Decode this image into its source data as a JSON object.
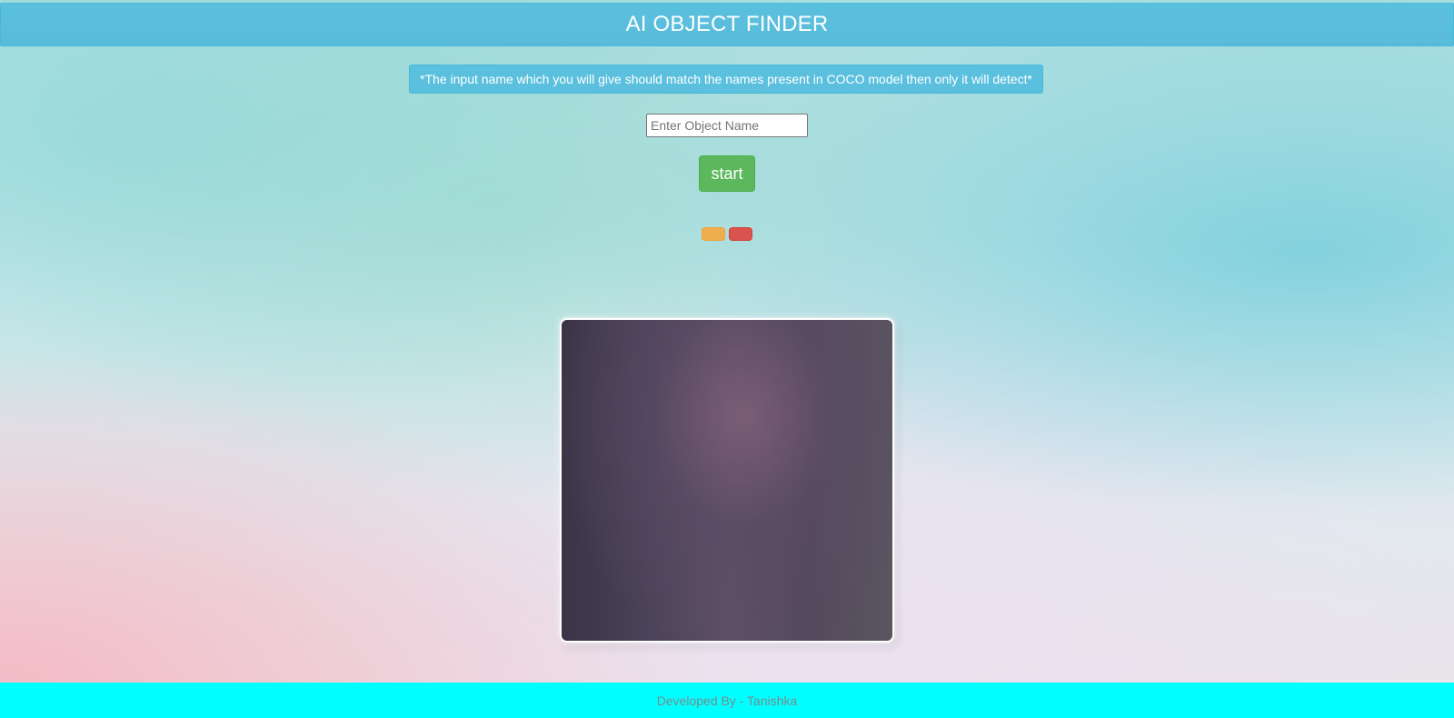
{
  "header": {
    "title": "AI OBJECT FINDER"
  },
  "notice": {
    "text": "*The input name which you will give should match the names present in COCO model then only it will detect*"
  },
  "object_input": {
    "placeholder": "Enter Object Name",
    "value": ""
  },
  "controls": {
    "start_label": "start",
    "warning_button_label": "",
    "danger_button_label": ""
  },
  "footer": {
    "text": "Developed By - Tanishka"
  },
  "colors": {
    "header": "#5bc0de",
    "start_button": "#5cb85c",
    "warning_button": "#f0ad4e",
    "danger_button": "#d9534f",
    "footer": "#00ffff"
  }
}
